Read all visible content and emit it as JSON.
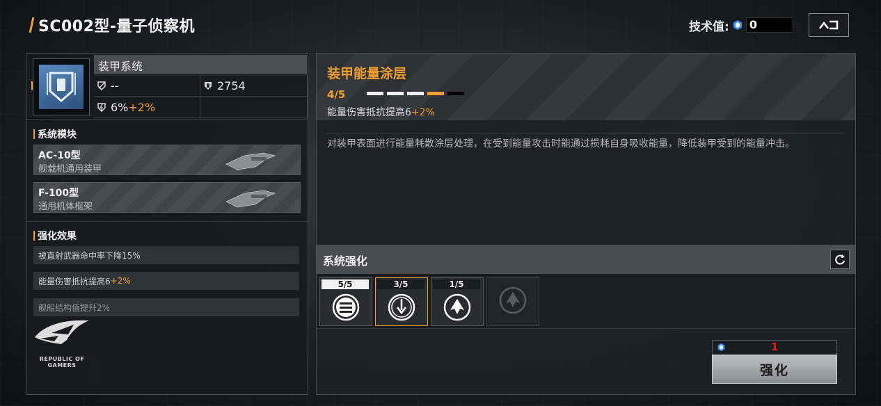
{
  "header": {
    "title": "SC002型-量子侦察机",
    "tech_label": "技术值:",
    "tech_value": "0",
    "back_icon": "back-arrow-icon"
  },
  "armor": {
    "name": "装甲系统",
    "stat1_value": "--",
    "stat2_value": "2754",
    "stat3_base": "6%",
    "stat3_bonus": "+2%"
  },
  "modules": {
    "title": "系统模块",
    "items": [
      {
        "name": "AC-10型",
        "sub": "舰载机通用装甲"
      },
      {
        "name": "F-100型",
        "sub": "通用机体框架"
      }
    ]
  },
  "effects": {
    "title": "强化效果",
    "items": [
      {
        "text": "被直射武器命中率下降15%",
        "bonus": ""
      },
      {
        "text": "能量伤害抵抗提高6",
        "bonus": "+2%"
      },
      {
        "text": "舰船结构值提升2%",
        "bonus": ""
      }
    ]
  },
  "rog": {
    "line1": "REPUBLIC OF",
    "line2": "GAMERS"
  },
  "skill": {
    "title": "装甲能量涂层",
    "level": "4/5",
    "level_value": 4,
    "level_max": 5,
    "effect_text": "能量伤害抵抗提高6",
    "effect_bonus": "+2%",
    "description": "对装甲表面进行能量耗散涂层处理，在受到能量攻击时能通过损耗自身吸收能量，降低装甲受到的能量冲击。"
  },
  "enhance": {
    "title": "系统强化",
    "slots": [
      {
        "level": "5/5",
        "icon": "menu-lines-icon"
      },
      {
        "level": "3/5",
        "icon": "drop-arrow-icon"
      },
      {
        "level": "1/5",
        "icon": "up-arrow-icon"
      },
      {
        "level": "",
        "icon": "locked-arrow-icon"
      }
    ],
    "cost": "1",
    "button_label": "强化"
  },
  "colors": {
    "accent": "#f0a030",
    "cost": "#e02020",
    "tech_icon": "#3a8ef0"
  }
}
